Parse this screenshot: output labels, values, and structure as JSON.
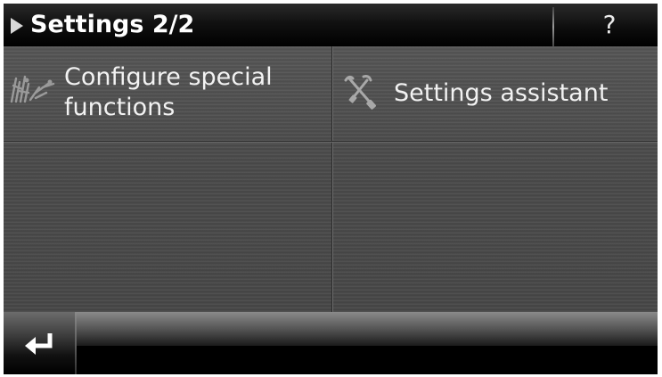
{
  "header": {
    "title": "Settings 2/2",
    "help_label": "?"
  },
  "menu": {
    "items": [
      {
        "label": "Configure special\nfunctions",
        "icon": "special-functions-icon"
      },
      {
        "label": "Settings assistant",
        "icon": "settings-assistant-icon"
      }
    ]
  },
  "footer": {
    "back_icon": "return-arrow-icon"
  }
}
